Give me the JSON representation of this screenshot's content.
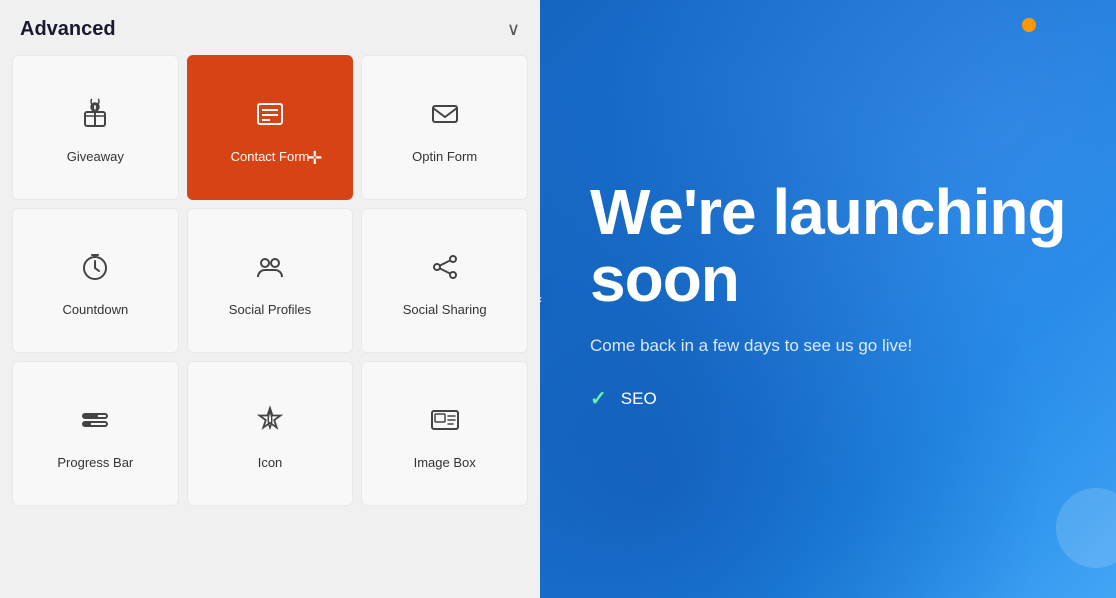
{
  "panel": {
    "title": "Advanced",
    "collapse_icon": "∨"
  },
  "widgets": [
    {
      "id": "giveaway",
      "label": "Giveaway",
      "icon": "giveaway",
      "active": false
    },
    {
      "id": "contact-form",
      "label": "Contact Form",
      "icon": "contact-form",
      "active": true
    },
    {
      "id": "optin-form",
      "label": "Optin Form",
      "icon": "optin-form",
      "active": false
    },
    {
      "id": "countdown",
      "label": "Countdown",
      "icon": "countdown",
      "active": false
    },
    {
      "id": "social-profiles",
      "label": "Social Profiles",
      "icon": "social-profiles",
      "active": false
    },
    {
      "id": "social-sharing",
      "label": "Social Sharing",
      "icon": "social-sharing",
      "active": false
    },
    {
      "id": "progress-bar",
      "label": "Progress Bar",
      "icon": "progress-bar",
      "active": false
    },
    {
      "id": "icon",
      "label": "Icon",
      "icon": "icon-widget",
      "active": false
    },
    {
      "id": "image-box",
      "label": "Image Box",
      "icon": "image-box",
      "active": false
    }
  ],
  "preview": {
    "heading": "We're launching soon",
    "subtext": "Come back in a few days to see us go live!",
    "features": [
      "SEO"
    ]
  }
}
